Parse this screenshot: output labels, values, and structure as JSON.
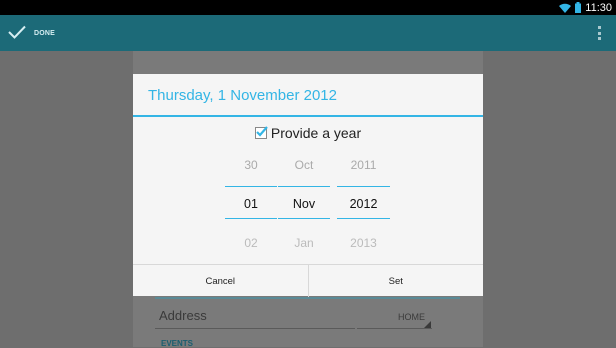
{
  "status_bar": {
    "time": "11:30",
    "wifi_icon": "wifi-icon",
    "battery_icon": "battery-icon"
  },
  "action_bar": {
    "done_label": "DONE",
    "done_icon": "checkmark-icon",
    "overflow_icon": "overflow-menu-icon",
    "color": "#1c6a78"
  },
  "background": {
    "address_label": "Address",
    "home_label": "HOME",
    "events_label": "EVENTS"
  },
  "dialog": {
    "title": "Thursday, 1 November 2012",
    "accent": "#33b5e5",
    "provide_year": {
      "label": "Provide a year",
      "checked": true
    },
    "picker": {
      "day": {
        "prev": "30",
        "selected": "01",
        "next": "02"
      },
      "month": {
        "prev": "Oct",
        "selected": "Nov",
        "next": "Jan"
      },
      "year": {
        "prev": "2011",
        "selected": "2012",
        "next": "2013"
      }
    },
    "buttons": {
      "cancel": "Cancel",
      "set": "Set"
    }
  }
}
